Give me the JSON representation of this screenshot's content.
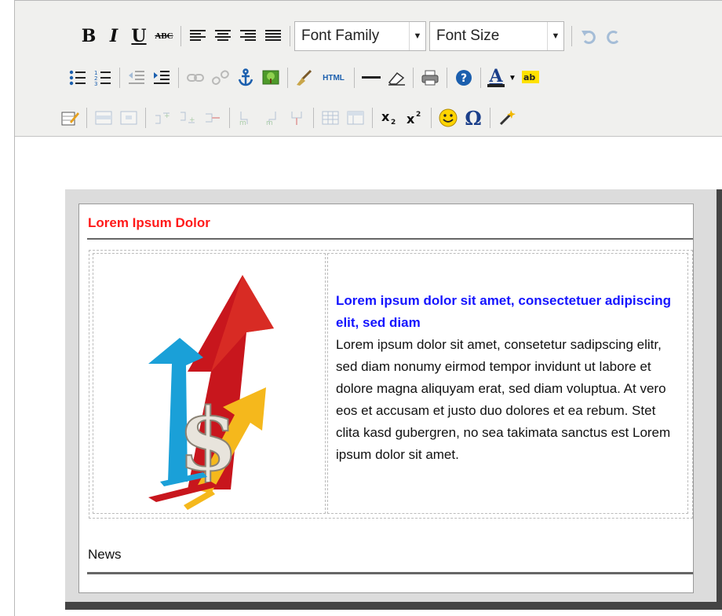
{
  "toolbar": {
    "font_family": "Font Family",
    "font_size": "Font Size",
    "html_label": "HTML",
    "bold": "B",
    "italic": "I",
    "underline": "U",
    "strike": "ABC",
    "omega": "Ω",
    "text_color": "A"
  },
  "content": {
    "title": "Lorem Ipsum Dolor",
    "headline": "Lorem ipsum dolor sit amet, consectetuer adipiscing elit, sed diam",
    "body": "Lorem ipsum dolor sit amet, consetetur sadipscing elitr, sed diam nonumy eirmod tempor invidunt ut labore et dolore magna aliquyam erat, sed diam voluptua. At vero eos et accusam et justo duo dolores et ea rebum. Stet clita kasd gubergren, no sea takimata sanctus est Lorem ipsum dolor sit amet.",
    "footer_label": "News"
  },
  "colors": {
    "title": "#ff1a1a",
    "headline": "#1414ff",
    "arrow_red": "#c8161d",
    "arrow_blue": "#1aa0d8",
    "arrow_yellow": "#f5b81c"
  }
}
